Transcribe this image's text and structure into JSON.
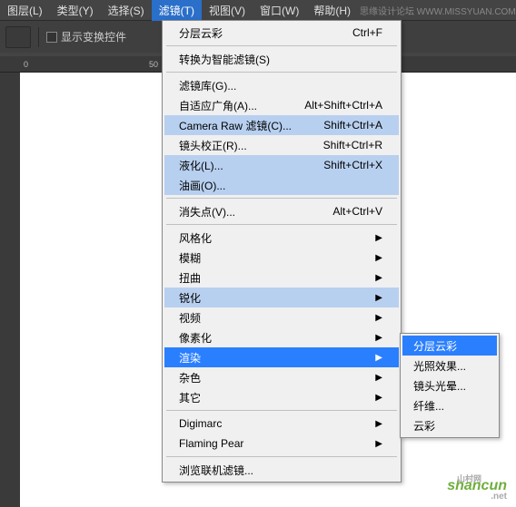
{
  "menubar": {
    "items": [
      {
        "label": "图层(L)"
      },
      {
        "label": "类型(Y)"
      },
      {
        "label": "选择(S)"
      },
      {
        "label": "滤镜(T)"
      },
      {
        "label": "视图(V)"
      },
      {
        "label": "窗口(W)"
      },
      {
        "label": "帮助(H)"
      }
    ],
    "tail": "思缘设计论坛  WWW.MISSYUAN.COM"
  },
  "toolbar": {
    "checkbox_label": "显示变换控件"
  },
  "ruler": {
    "ticks": [
      {
        "pos": 32,
        "label": "0"
      },
      {
        "pos": 174,
        "label": "50"
      }
    ]
  },
  "filter_menu": {
    "groups": [
      [
        {
          "label": "分层云彩",
          "shortcut": "Ctrl+F",
          "hl": false
        }
      ],
      [
        {
          "label": "转换为智能滤镜(S)"
        }
      ],
      [
        {
          "label": "滤镜库(G)..."
        },
        {
          "label": "自适应广角(A)...",
          "shortcut": "Alt+Shift+Ctrl+A"
        },
        {
          "label": "Camera Raw 滤镜(C)...",
          "shortcut": "Shift+Ctrl+A",
          "hl": true
        },
        {
          "label": "镜头校正(R)...",
          "shortcut": "Shift+Ctrl+R"
        },
        {
          "label": "液化(L)...",
          "shortcut": "Shift+Ctrl+X",
          "hl": true
        },
        {
          "label": "油画(O)...",
          "hl": true
        }
      ],
      [
        {
          "label": "消失点(V)...",
          "shortcut": "Alt+Ctrl+V"
        }
      ],
      [
        {
          "label": "风格化",
          "submenu": true
        },
        {
          "label": "模糊",
          "submenu": true
        },
        {
          "label": "扭曲",
          "submenu": true
        },
        {
          "label": "锐化",
          "submenu": true,
          "hl": true
        },
        {
          "label": "视频",
          "submenu": true
        },
        {
          "label": "像素化",
          "submenu": true
        },
        {
          "label": "渲染",
          "submenu": true,
          "hover": true
        },
        {
          "label": "杂色",
          "submenu": true
        },
        {
          "label": "其它",
          "submenu": true
        }
      ],
      [
        {
          "label": "Digimarc",
          "submenu": true
        },
        {
          "label": "Flaming Pear",
          "submenu": true
        }
      ],
      [
        {
          "label": "浏览联机滤镜..."
        }
      ]
    ]
  },
  "render_submenu": {
    "items": [
      {
        "label": "分层云彩",
        "hover": true
      },
      {
        "label": "光照效果..."
      },
      {
        "label": "镜头光晕..."
      },
      {
        "label": "纤维..."
      },
      {
        "label": "云彩"
      }
    ]
  },
  "watermark": {
    "main": "shancun",
    "net": ".net",
    "cn": "山村网"
  }
}
